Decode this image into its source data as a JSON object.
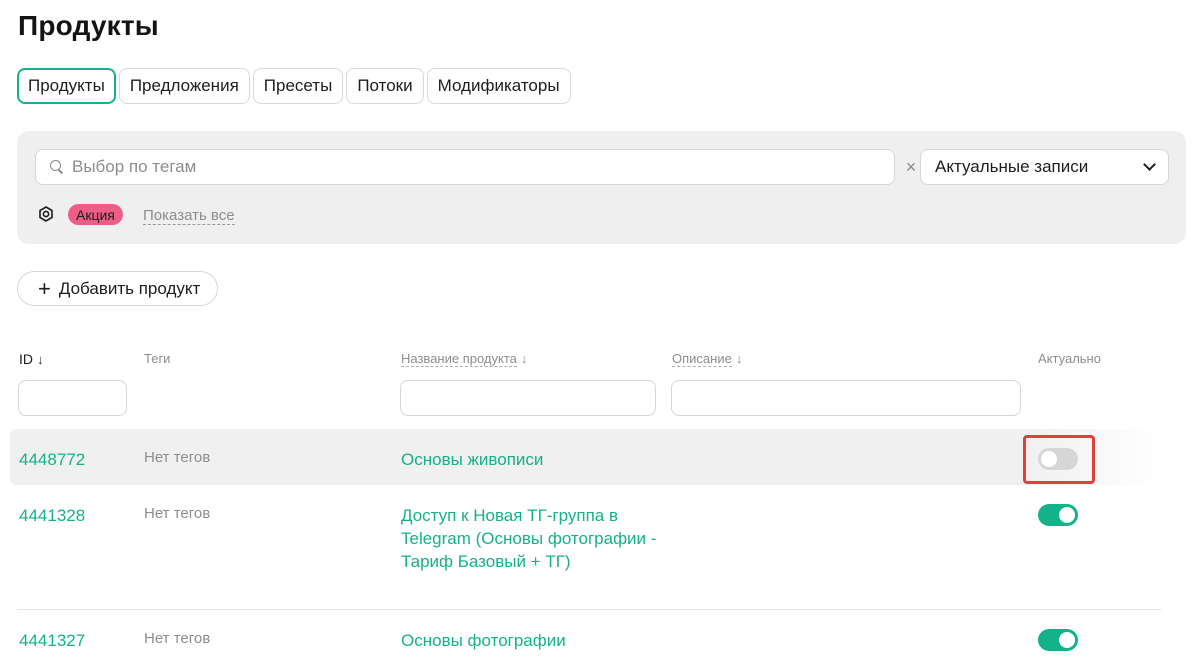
{
  "page": {
    "title": "Продукты"
  },
  "tabs": [
    {
      "label": "Продукты",
      "active": true
    },
    {
      "label": "Предложения",
      "active": false
    },
    {
      "label": "Пресеты",
      "active": false
    },
    {
      "label": "Потоки",
      "active": false
    },
    {
      "label": "Модификаторы",
      "active": false
    }
  ],
  "filters": {
    "search_placeholder": "Выбор по тегам",
    "clear_symbol": "×",
    "status_select": "Актуальные записи",
    "tag_chip": "Акция",
    "show_all": "Показать все"
  },
  "actions": {
    "add_product": "Добавить продукт"
  },
  "table": {
    "columns": {
      "id": "ID",
      "tags": "Теги",
      "name": "Название продукта",
      "description": "Описание",
      "actual": "Актуально"
    },
    "rows": [
      {
        "id": "4448772",
        "tags": "Нет тегов",
        "name": "Основы живописи",
        "actual": false
      },
      {
        "id": "4441328",
        "tags": "Нет тегов",
        "name": "Доступ к Новая ТГ-группа в Telegram (Основы фотографии - Тариф Базовый + ТГ)",
        "actual": true
      },
      {
        "id": "4441327",
        "tags": "Нет тегов",
        "name": "Основы фотографии",
        "actual": true
      }
    ]
  },
  "colors": {
    "accent": "#14b28a",
    "tag_chip": "#ee5d86",
    "highlight": "#e04040"
  }
}
